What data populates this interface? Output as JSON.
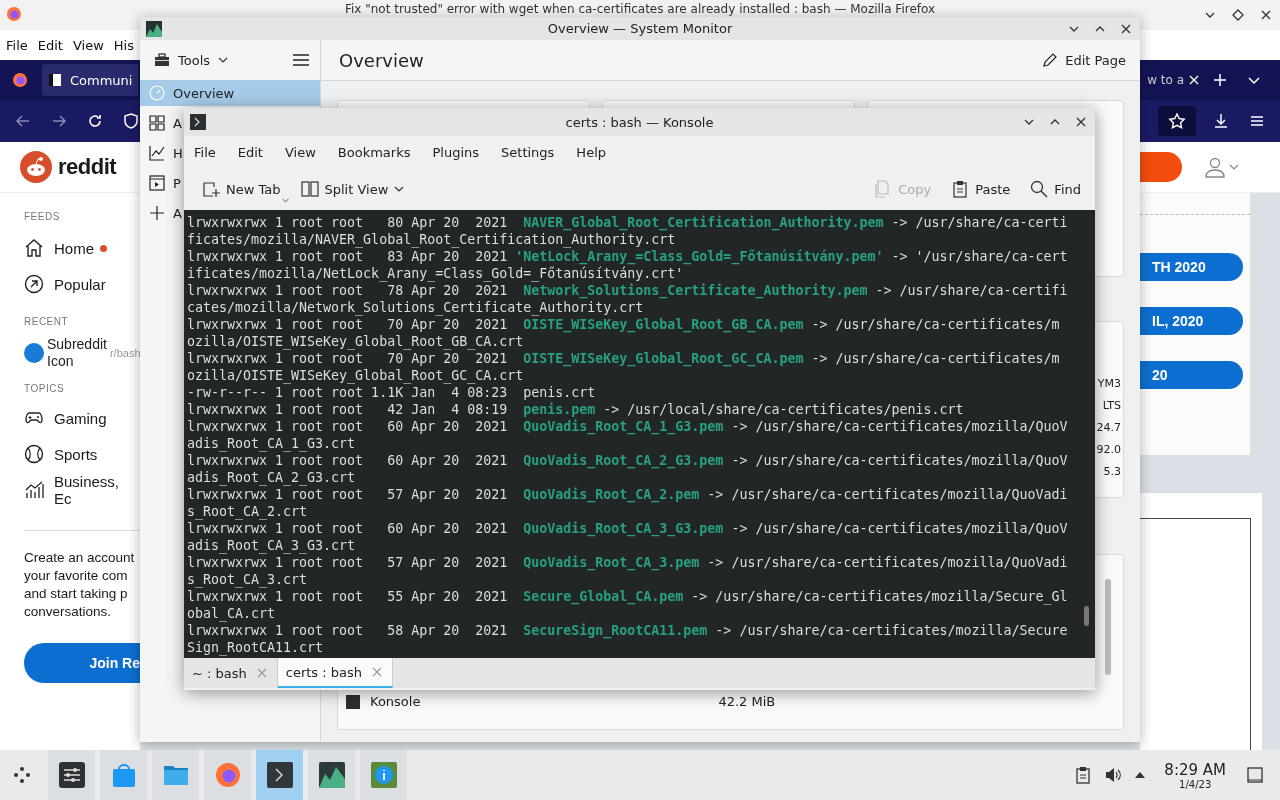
{
  "firefox": {
    "title": "Fix \"not trusted\" error with wget when ca-certificates are already installed : bash — Mozilla Firefox",
    "menu": [
      "File",
      "Edit",
      "View",
      "His"
    ],
    "tabs": [
      {
        "label": "Communi",
        "selected": true
      },
      {
        "label": "w to a",
        "selected": false
      }
    ],
    "reddit": {
      "logo": "reddit",
      "feeds_heading": "FEEDS",
      "feeds": [
        {
          "label": "Home",
          "kind": "home",
          "unread": true
        },
        {
          "label": "Popular",
          "kind": "popular",
          "unread": false
        }
      ],
      "recent_heading": "RECENT",
      "recent": [
        {
          "label": "r/bash",
          "icon_alt": "Subreddit Icon"
        }
      ],
      "topics_heading": "TOPICS",
      "topics": [
        {
          "label": "Gaming",
          "kind": "gaming"
        },
        {
          "label": "Sports",
          "kind": "sports"
        },
        {
          "label": "Business, Ec",
          "kind": "business"
        }
      ],
      "signup_text": "Create an account\nyour favorite com\nand start taking p\nconversations.",
      "join_button": "Join Re",
      "pills": [
        "TH 2020",
        "IL, 2020",
        "20"
      ]
    }
  },
  "system_monitor": {
    "title": "Overview — System Monitor",
    "tools": "Tools",
    "pages": [
      {
        "label": "Overview",
        "kind": "overview",
        "selected": true
      },
      {
        "label": "A",
        "kind": "applications",
        "selected": false
      },
      {
        "label": "H",
        "kind": "history",
        "selected": false
      },
      {
        "label": "P",
        "kind": "processes",
        "selected": false
      },
      {
        "label": "A",
        "kind": "add",
        "selected": false
      }
    ],
    "heading": "Overview",
    "edit_page": "Edit Page",
    "system_values": [
      "YM3",
      "LTS",
      "24.7",
      "92.0",
      "5.3"
    ],
    "process_row": {
      "name": "Konsole",
      "memory": "42.2 MiB"
    }
  },
  "konsole": {
    "title": "certs : bash — Konsole",
    "menu": [
      "File",
      "Edit",
      "View",
      "Bookmarks",
      "Plugins",
      "Settings",
      "Help"
    ],
    "toolbar": [
      {
        "label": "New Tab",
        "kind": "new-tab",
        "disabled": false
      },
      {
        "label": "Split View",
        "kind": "split-view",
        "disabled": false
      },
      {
        "label": "Copy",
        "kind": "copy",
        "disabled": true
      },
      {
        "label": "Paste",
        "kind": "paste",
        "disabled": false
      },
      {
        "label": "Find",
        "kind": "find",
        "disabled": false
      }
    ],
    "lines": [
      {
        "kind": "symlink",
        "meta": "lrwxrwxrwx 1 root root   80 Apr 20  2021  ",
        "name": "NAVER_Global_Root_Certification_Authority.pem",
        "target": " -> /usr/share/ca-certificates/mozilla/NAVER_Global_Root_Certification_Authority.crt"
      },
      {
        "kind": "symlink",
        "meta": "lrwxrwxrwx 1 root root   83 Apr 20  2021 ",
        "name": "'NetLock_Arany_=Class_Gold=_Főtanúsítvány.pem'",
        "target": " -> '/usr/share/ca-certificates/mozilla/NetLock_Arany_=Class_Gold=_Főtanúsítvány.crt'"
      },
      {
        "kind": "symlink",
        "meta": "lrwxrwxrwx 1 root root   78 Apr 20  2021  ",
        "name": "Network_Solutions_Certificate_Authority.pem",
        "target": " -> /usr/share/ca-certificates/mozilla/Network_Solutions_Certificate_Authority.crt"
      },
      {
        "kind": "symlink",
        "meta": "lrwxrwxrwx 1 root root   70 Apr 20  2021  ",
        "name": "OISTE_WISeKey_Global_Root_GB_CA.pem",
        "target": " -> /usr/share/ca-certificates/mozilla/OISTE_WISeKey_Global_Root_GB_CA.crt"
      },
      {
        "kind": "symlink",
        "meta": "lrwxrwxrwx 1 root root   70 Apr 20  2021  ",
        "name": "OISTE_WISeKey_Global_Root_GC_CA.pem",
        "target": " -> /usr/share/ca-certificates/mozilla/OISTE_WISeKey_Global_Root_GC_CA.crt"
      },
      {
        "kind": "file",
        "meta": "-rw-r--r-- 1 root root 1.1K Jan  4 08:23  ",
        "name": "penis.crt"
      },
      {
        "kind": "symlink",
        "meta": "lrwxrwxrwx 1 root root   42 Jan  4 08:19  ",
        "name": "penis.pem",
        "target": " -> /usr/local/share/ca-certificates/penis.crt"
      },
      {
        "kind": "symlink",
        "meta": "lrwxrwxrwx 1 root root   60 Apr 20  2021  ",
        "name": "QuoVadis_Root_CA_1_G3.pem",
        "target": " -> /usr/share/ca-certificates/mozilla/QuoVadis_Root_CA_1_G3.crt"
      },
      {
        "kind": "symlink",
        "meta": "lrwxrwxrwx 1 root root   60 Apr 20  2021  ",
        "name": "QuoVadis_Root_CA_2_G3.pem",
        "target": " -> /usr/share/ca-certificates/mozilla/QuoVadis_Root_CA_2_G3.crt"
      },
      {
        "kind": "symlink",
        "meta": "lrwxrwxrwx 1 root root   57 Apr 20  2021  ",
        "name": "QuoVadis_Root_CA_2.pem",
        "target": " -> /usr/share/ca-certificates/mozilla/QuoVadis_Root_CA_2.crt"
      },
      {
        "kind": "symlink",
        "meta": "lrwxrwxrwx 1 root root   60 Apr 20  2021  ",
        "name": "QuoVadis_Root_CA_3_G3.pem",
        "target": " -> /usr/share/ca-certificates/mozilla/QuoVadis_Root_CA_3_G3.crt"
      },
      {
        "kind": "symlink",
        "meta": "lrwxrwxrwx 1 root root   57 Apr 20  2021  ",
        "name": "QuoVadis_Root_CA_3.pem",
        "target": " -> /usr/share/ca-certificates/mozilla/QuoVadis_Root_CA_3.crt"
      },
      {
        "kind": "symlink",
        "meta": "lrwxrwxrwx 1 root root   55 Apr 20  2021  ",
        "name": "Secure_Global_CA.pem",
        "target": " -> /usr/share/ca-certificates/mozilla/Secure_Global_CA.crt"
      },
      {
        "kind": "symlink",
        "meta": "lrwxrwxrwx 1 root root   58 Apr 20  2021  ",
        "name": "SecureSign_RootCA11.pem",
        "target": " -> /usr/share/ca-certificates/mozilla/SecureSign_RootCA11.crt"
      }
    ],
    "tabs": [
      {
        "label": "~ : bash",
        "selected": false
      },
      {
        "label": "certs : bash",
        "selected": true
      }
    ]
  },
  "taskbar": {
    "apps": [
      {
        "kind": "settings",
        "selected": false
      },
      {
        "kind": "discover",
        "selected": false
      },
      {
        "kind": "files",
        "selected": false
      },
      {
        "kind": "firefox",
        "selected": false
      },
      {
        "kind": "konsole",
        "selected": true
      },
      {
        "kind": "system-monitor",
        "selected": false
      },
      {
        "kind": "info",
        "selected": false
      }
    ],
    "clock": {
      "time": "8:29 AM",
      "date": "1/4/23"
    }
  }
}
